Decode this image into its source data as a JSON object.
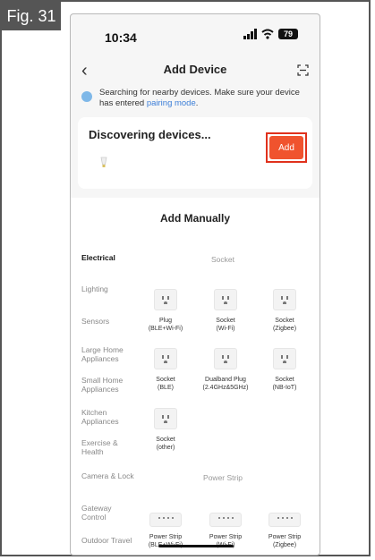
{
  "figure_label": "Fig. 31",
  "status_bar": {
    "time": "10:34",
    "battery": "79"
  },
  "nav": {
    "back_icon": "chevron-left-icon",
    "title": "Add Device",
    "scan_icon": "scan-icon"
  },
  "notice": {
    "text": "Searching for nearby devices. Make sure your device has entered ",
    "link": "pairing mode",
    "suffix": "."
  },
  "discover": {
    "title": "Discovering devices...",
    "add_label": "Add",
    "highlight_color": "#e0311c",
    "button_color": "#f0532e"
  },
  "manual": {
    "title": "Add Manually",
    "categories": [
      {
        "label": "Electrical",
        "active": true
      },
      {
        "label": "Lighting"
      },
      {
        "label": "Sensors"
      },
      {
        "label": "Large Home Appliances"
      },
      {
        "label": "Small Home Appliances"
      },
      {
        "label": "Kitchen Appliances"
      },
      {
        "label": "Exercise & Health"
      },
      {
        "label": "Camera & Lock"
      },
      {
        "label": "Gateway Control"
      },
      {
        "label": "Outdoor Travel"
      }
    ],
    "sections": [
      {
        "label": "Socket"
      },
      {
        "label": "Power Strip"
      }
    ],
    "socket_tiles": [
      {
        "line1": "Plug",
        "line2": "(BLE+Wi-Fi)"
      },
      {
        "line1": "Socket",
        "line2": "(Wi-Fi)"
      },
      {
        "line1": "Socket",
        "line2": "(Zigbee)"
      },
      {
        "line1": "Socket",
        "line2": "(BLE)"
      },
      {
        "line1": "Dualband Plug",
        "line2": "(2.4GHz&5GHz)"
      },
      {
        "line1": "Socket",
        "line2": "(NB-IoT)"
      },
      {
        "line1": "Socket",
        "line2": "(other)"
      }
    ],
    "strip_tiles": [
      {
        "line1": "Power Strip",
        "line2": "(BLE+Wi-Fi)"
      },
      {
        "line1": "Power Strip",
        "line2": "(Wi-Fi)"
      },
      {
        "line1": "Power Strip",
        "line2": "(Zigbee)"
      }
    ]
  }
}
